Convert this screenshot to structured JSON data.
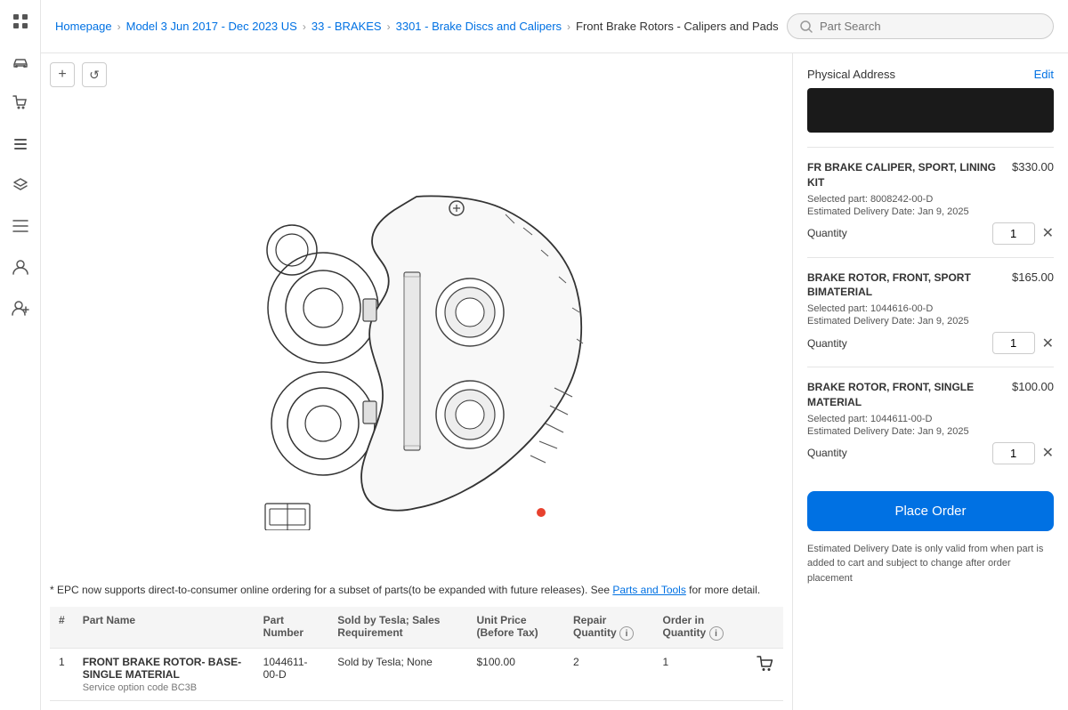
{
  "sidebar": {
    "icons": [
      {
        "name": "grid-icon",
        "symbol": "⊞"
      },
      {
        "name": "car-icon",
        "symbol": "🚗"
      },
      {
        "name": "cart-icon",
        "symbol": "🛒"
      },
      {
        "name": "list-icon",
        "symbol": "📋"
      },
      {
        "name": "layers-icon",
        "symbol": "⧉"
      },
      {
        "name": "menu-icon",
        "symbol": "☰"
      },
      {
        "name": "user-icon",
        "symbol": "👤"
      },
      {
        "name": "person-add-icon",
        "symbol": "👥"
      }
    ]
  },
  "breadcrumb": {
    "items": [
      {
        "label": "Homepage",
        "link": true
      },
      {
        "label": "Model 3 Jun 2017 - Dec 2023 US",
        "link": true
      },
      {
        "label": "33 - BRAKES",
        "link": true
      },
      {
        "label": "3301 - Brake Discs and Calipers",
        "link": true
      },
      {
        "label": "Front Brake Rotors - Calipers and Pads",
        "link": false
      }
    ],
    "search": {
      "placeholder": "Part Search",
      "value": ""
    }
  },
  "toolbar": {
    "zoom_in": "+",
    "zoom_out": "−",
    "rotate": "↺"
  },
  "notice": {
    "text": "* EPC now supports direct-to-consumer online ordering for a subset of parts(to be expanded with future releases). See ",
    "link_text": "Parts and Tools",
    "text_after": " for more detail."
  },
  "table": {
    "columns": [
      "#",
      "Part Name",
      "Part Number",
      "Sold by Tesla; Sales Requirement",
      "Unit Price (Before Tax)",
      "Repair Quantity",
      "",
      "Order in Quantity",
      ""
    ],
    "rows": [
      {
        "num": "1",
        "name": "FRONT BRAKE ROTOR- BASE- SINGLE MATERIAL",
        "service_option": "Service option code BC3B",
        "part_number": "1044611-00-D",
        "sold_by": "Sold by Tesla; None",
        "unit_price": "$100.00",
        "repair_qty": "2",
        "order_qty": "1"
      }
    ]
  },
  "right_panel": {
    "address_label": "Physical Address",
    "edit_label": "Edit",
    "cart_items": [
      {
        "title": "FR BRAKE CALIPER, SPORT, LINING KIT",
        "price": "$330.00",
        "part_number": "8008242-00-D",
        "delivery": "Jan 9, 2025",
        "qty": "1"
      },
      {
        "title": "BRAKE ROTOR, FRONT, SPORT BIMATERIAL",
        "price": "$165.00",
        "part_number": "1044616-00-D",
        "delivery": "Jan 9, 2025",
        "qty": "1"
      },
      {
        "title": "BRAKE ROTOR, FRONT, SINGLE MATERIAL",
        "price": "$100.00",
        "part_number": "1044611-00-D",
        "delivery": "Jan 9, 2025",
        "qty": "1"
      }
    ],
    "place_order_label": "Place Order",
    "delivery_notice": "Estimated Delivery Date is only valid from when part is added to cart and subject to change after order placement"
  }
}
